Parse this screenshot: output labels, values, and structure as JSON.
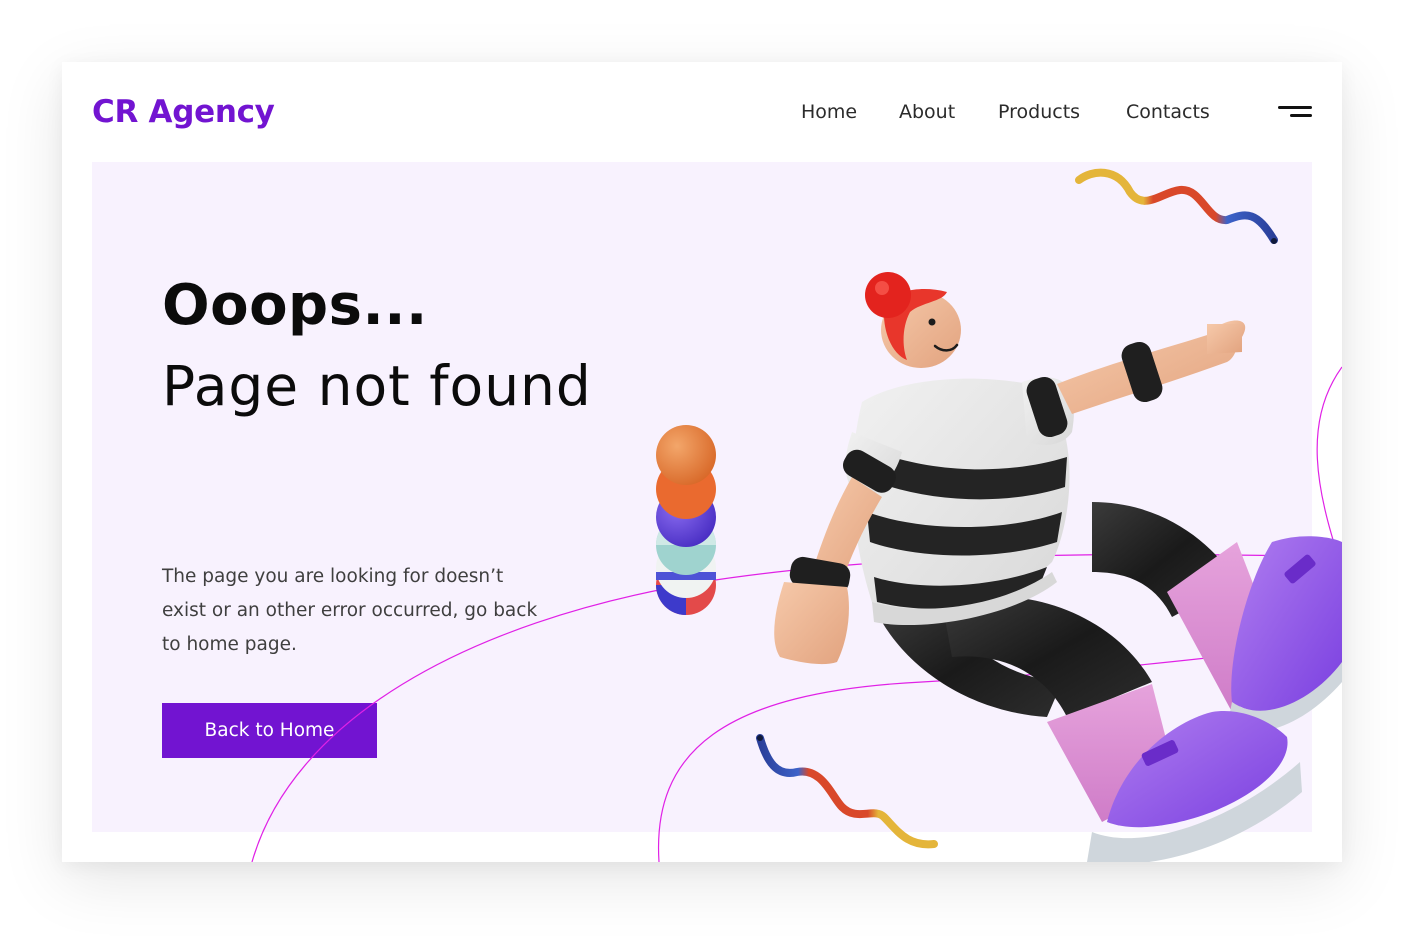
{
  "brand": {
    "name": "CR Agency"
  },
  "nav": {
    "items": [
      {
        "label": "Home"
      },
      {
        "label": "About"
      },
      {
        "label": "Products"
      },
      {
        "label": "Contacts"
      }
    ],
    "menu_icon": "hamburger-menu-icon"
  },
  "hero": {
    "title_line1": "Ooops...",
    "title_line2": "Page not found",
    "description": "The page you are looking for doesn’t exist or an other error occurred, go back to home page.",
    "button_label": "Back to Home",
    "illustration": "3d-character-flying-illustration"
  },
  "colors": {
    "brand": "#7214d1",
    "hero_background": "#f8f2fe",
    "text": "#0b0b0b",
    "accent_line": "#e021e6"
  }
}
